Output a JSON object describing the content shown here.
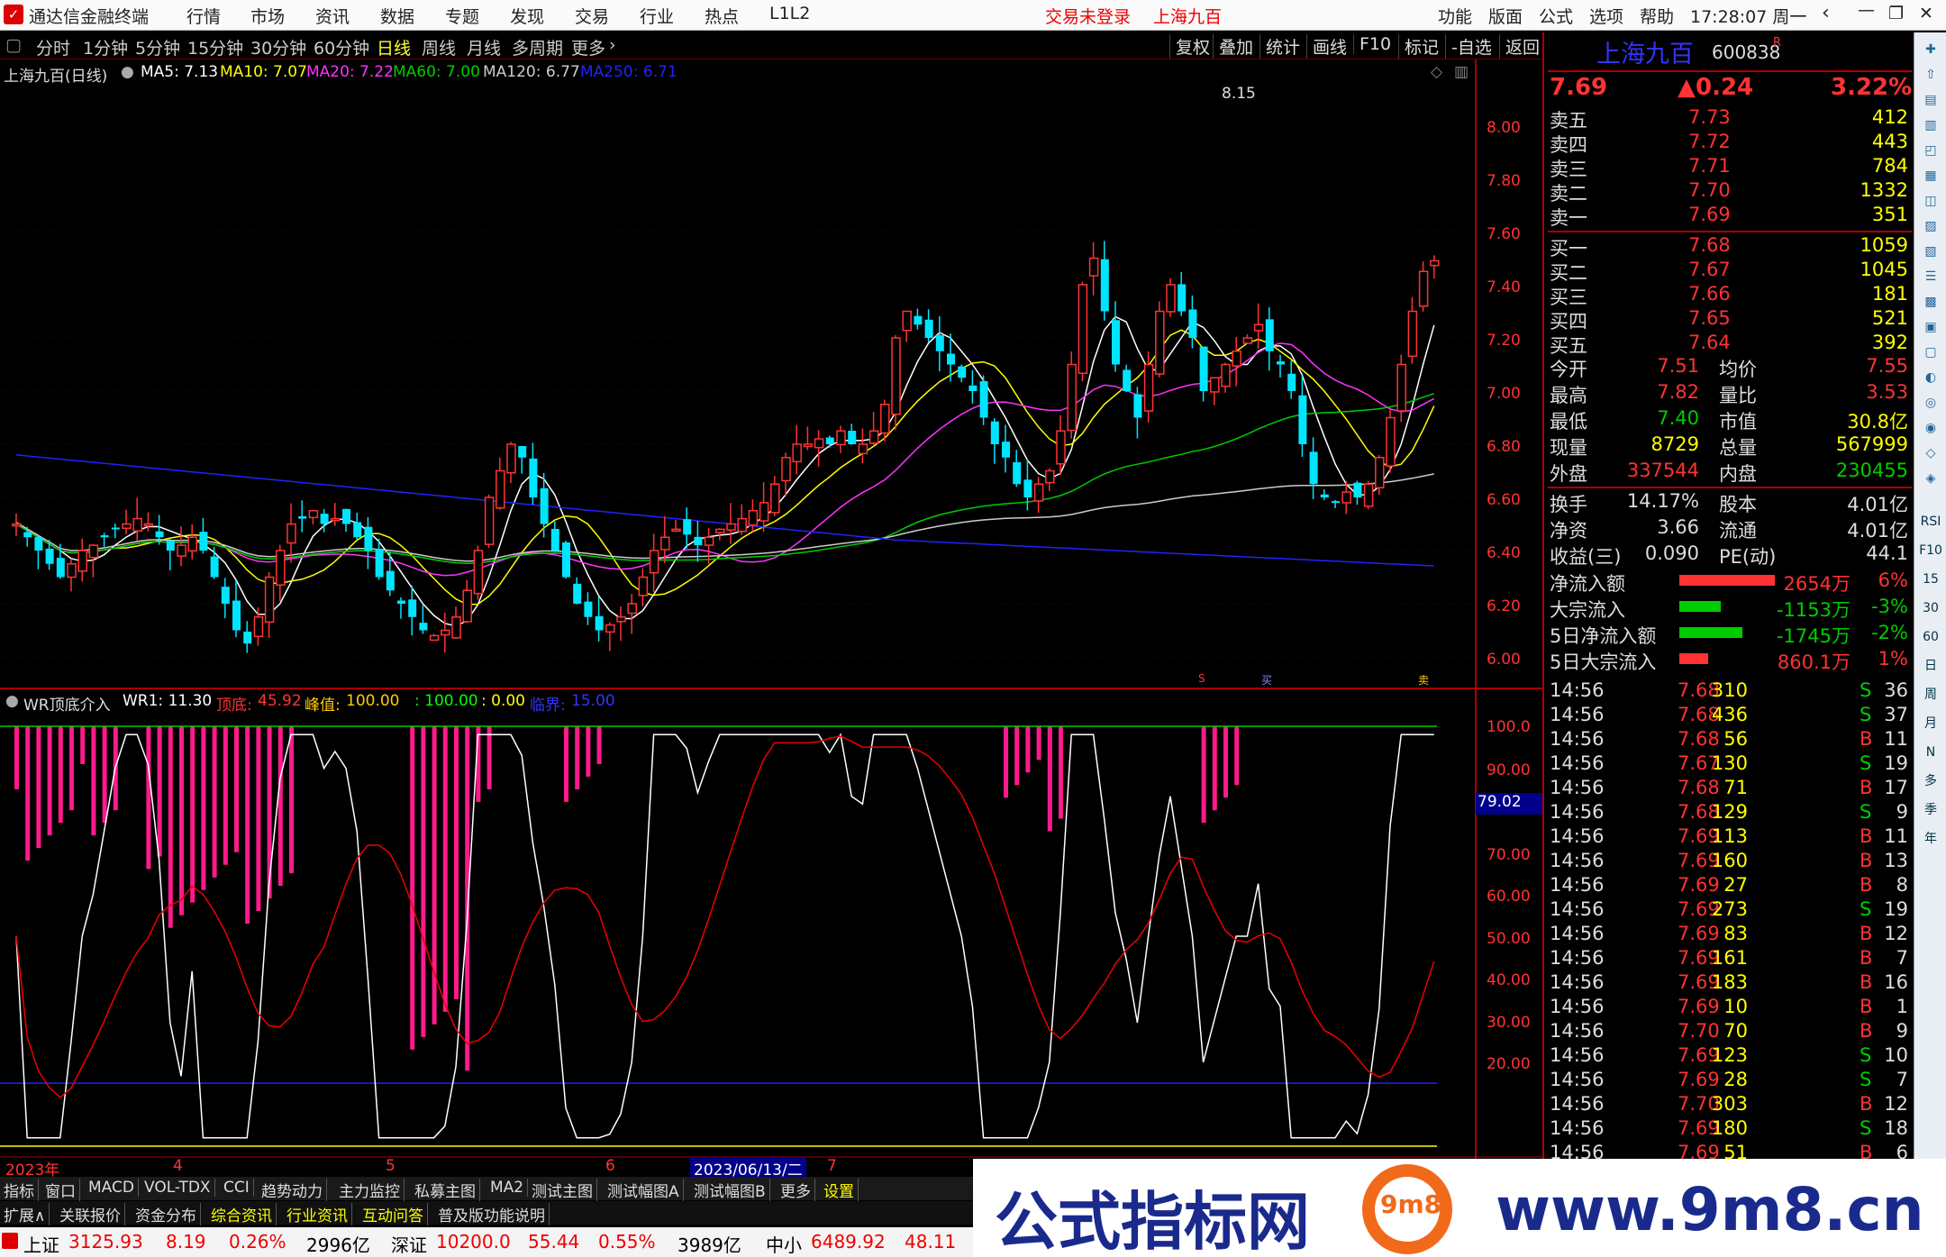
{
  "titlebar": {
    "app_name": "通达信金融终端",
    "menus": [
      "行情",
      "市场",
      "资讯",
      "数据",
      "专题",
      "发现",
      "交易",
      "行业",
      "热点",
      "L1L2"
    ],
    "login": "交易未登录",
    "stock": "上海九百",
    "right_menus": [
      "功能",
      "版面",
      "公式",
      "选项",
      "帮助"
    ],
    "time": "17:28:07 周一"
  },
  "periods": [
    "分时",
    "1分钟",
    "5分钟",
    "15分钟",
    "30分钟",
    "60分钟",
    "日线",
    "周线",
    "月线",
    "多周期",
    "更多"
  ],
  "active_period": "日线",
  "toolbar": [
    "复权",
    "叠加",
    "统计",
    "画线",
    "F10",
    "标记",
    "-自选",
    "返回"
  ],
  "main_legend": {
    "name": "上海九百(日线)",
    "ma5": "MA5: 7.13",
    "ma10": "MA10: 7.07",
    "ma20": "MA20: 7.22",
    "ma60": "MA60: 7.00",
    "ma120": "MA120: 6.77",
    "ma250": "MA250: 6.71"
  },
  "price_axis": [
    "8.00",
    "7.80",
    "7.60",
    "7.40",
    "7.20",
    "7.00",
    "6.80",
    "6.60",
    "6.40",
    "6.20",
    "6.00"
  ],
  "high_mark": "8.15",
  "indicator_legend": {
    "name": "WR顶底介入",
    "wr1": "WR1: 11.30",
    "top_bottom_label": "顶底:",
    "top_bottom": "45.92",
    "peak_label": "峰值:",
    "peak": "100.00",
    "v1": ": 100.00",
    "v2": ": 0.00",
    "crit_label": "临界:",
    "crit": "15.00"
  },
  "wr_axis": [
    "100.0",
    "90.00",
    "70.00",
    "60.00",
    "50.00",
    "40.00",
    "30.00",
    "20.00"
  ],
  "wr_cursor": "79.02",
  "date_axis": [
    "2023年",
    "4",
    "5",
    "6",
    "2023/06/13/二",
    "7"
  ],
  "markers": [
    "S",
    "买",
    "卖"
  ],
  "quote": {
    "name": "上海九百",
    "code": "600838",
    "tag": "R",
    "price": "7.69",
    "change": "▲0.24",
    "pct": "3.22%",
    "asks": [
      [
        "卖五",
        "7.73",
        "412"
      ],
      [
        "卖四",
        "7.72",
        "443"
      ],
      [
        "卖三",
        "7.71",
        "784"
      ],
      [
        "卖二",
        "7.70",
        "1332"
      ],
      [
        "卖一",
        "7.69",
        "351"
      ]
    ],
    "bids": [
      [
        "买一",
        "7.68",
        "1059"
      ],
      [
        "买二",
        "7.67",
        "1045"
      ],
      [
        "买三",
        "7.66",
        "181"
      ],
      [
        "买四",
        "7.65",
        "521"
      ],
      [
        "买五",
        "7.64",
        "392"
      ]
    ],
    "stats": [
      [
        "今开",
        "7.51",
        "均价",
        "7.55"
      ],
      [
        "最高",
        "7.82",
        "量比",
        "3.53"
      ],
      [
        "最低",
        "7.40",
        "市值",
        "30.8亿"
      ],
      [
        "现量",
        "8729",
        "总量",
        "567999"
      ],
      [
        "外盘",
        "337544",
        "内盘",
        "230455"
      ]
    ],
    "stats2": [
      [
        "换手",
        "14.17%",
        "股本",
        "4.01亿"
      ],
      [
        "净资",
        "3.66",
        "流通",
        "4.01亿"
      ],
      [
        "收益(三)",
        "0.090",
        "PE(动)",
        "44.1"
      ]
    ],
    "flows": [
      [
        "净流入额",
        "2654万",
        "6%"
      ],
      [
        "大宗流入",
        "-1153万",
        "-3%"
      ],
      [
        "5日净流入额",
        "-1745万",
        "-2%"
      ],
      [
        "5日大宗流入",
        "860.1万",
        "1%"
      ]
    ],
    "ticks": [
      [
        "14:56",
        "7.68",
        "310",
        "S",
        "36"
      ],
      [
        "14:56",
        "7.68",
        "436",
        "S",
        "37"
      ],
      [
        "14:56",
        "7.68",
        "56",
        "B",
        "11"
      ],
      [
        "14:56",
        "7.67",
        "130",
        "S",
        "19"
      ],
      [
        "14:56",
        "7.68",
        "71",
        "B",
        "17"
      ],
      [
        "14:56",
        "7.68",
        "129",
        "S",
        "9"
      ],
      [
        "14:56",
        "7.69",
        "113",
        "B",
        "11"
      ],
      [
        "14:56",
        "7.69",
        "160",
        "B",
        "13"
      ],
      [
        "14:56",
        "7.69",
        "27",
        "B",
        "8"
      ],
      [
        "14:56",
        "7.69",
        "273",
        "S",
        "19"
      ],
      [
        "14:56",
        "7.69",
        "83",
        "B",
        "12"
      ],
      [
        "14:56",
        "7.69",
        "161",
        "B",
        "7"
      ],
      [
        "14:56",
        "7.69",
        "183",
        "B",
        "16"
      ],
      [
        "14:56",
        "7.69",
        "10",
        "B",
        "1"
      ],
      [
        "14:56",
        "7.70",
        "70",
        "B",
        "9"
      ],
      [
        "14:56",
        "7.69",
        "123",
        "S",
        "10"
      ],
      [
        "14:56",
        "7.69",
        "28",
        "S",
        "7"
      ],
      [
        "14:56",
        "7.70",
        "303",
        "B",
        "12"
      ],
      [
        "14:56",
        "7.69",
        "180",
        "S",
        "18"
      ],
      [
        "14:56",
        "7.69",
        "51",
        "B",
        "6"
      ]
    ]
  },
  "right_icons": [
    "RSI",
    "F10",
    "15",
    "30",
    "60",
    "日",
    "周",
    "月",
    "N",
    "多",
    "季",
    "年"
  ],
  "bottom_tabs": [
    "指标",
    "窗口",
    "MACD",
    "VOL-TDX",
    "CCI",
    "趋势动力",
    "主力监控",
    "私募主图",
    "MA2",
    "测试主图",
    "测试幅图A",
    "测试幅图B",
    "更多",
    "设置"
  ],
  "bottom_tabs2": [
    "扩展∧",
    "关联报价",
    "资金分布",
    "综合资讯",
    "行业资讯",
    "互动问答",
    "普及版功能说明"
  ],
  "status": [
    [
      "上证",
      "3125.93",
      "8.19",
      "0.26%",
      "2996亿"
    ],
    [
      "深证",
      "10200.0",
      "55.44",
      "0.55%",
      "3989亿"
    ],
    [
      "中小",
      "6489.92",
      "48.11"
    ]
  ],
  "watermark": {
    "text": "公式指标网",
    "url": "www.9m8.cn",
    "logo_text": "9m8"
  },
  "colors": {
    "up": "#ff3333",
    "down": "#00e5ff",
    "ma5": "#ffffff",
    "ma10": "#ffff00",
    "ma20": "#ff33ff",
    "ma60": "#00cc00",
    "ma120": "#cccccc",
    "ma250": "#2222ff",
    "wr_bar": "#ff1a8c"
  }
}
